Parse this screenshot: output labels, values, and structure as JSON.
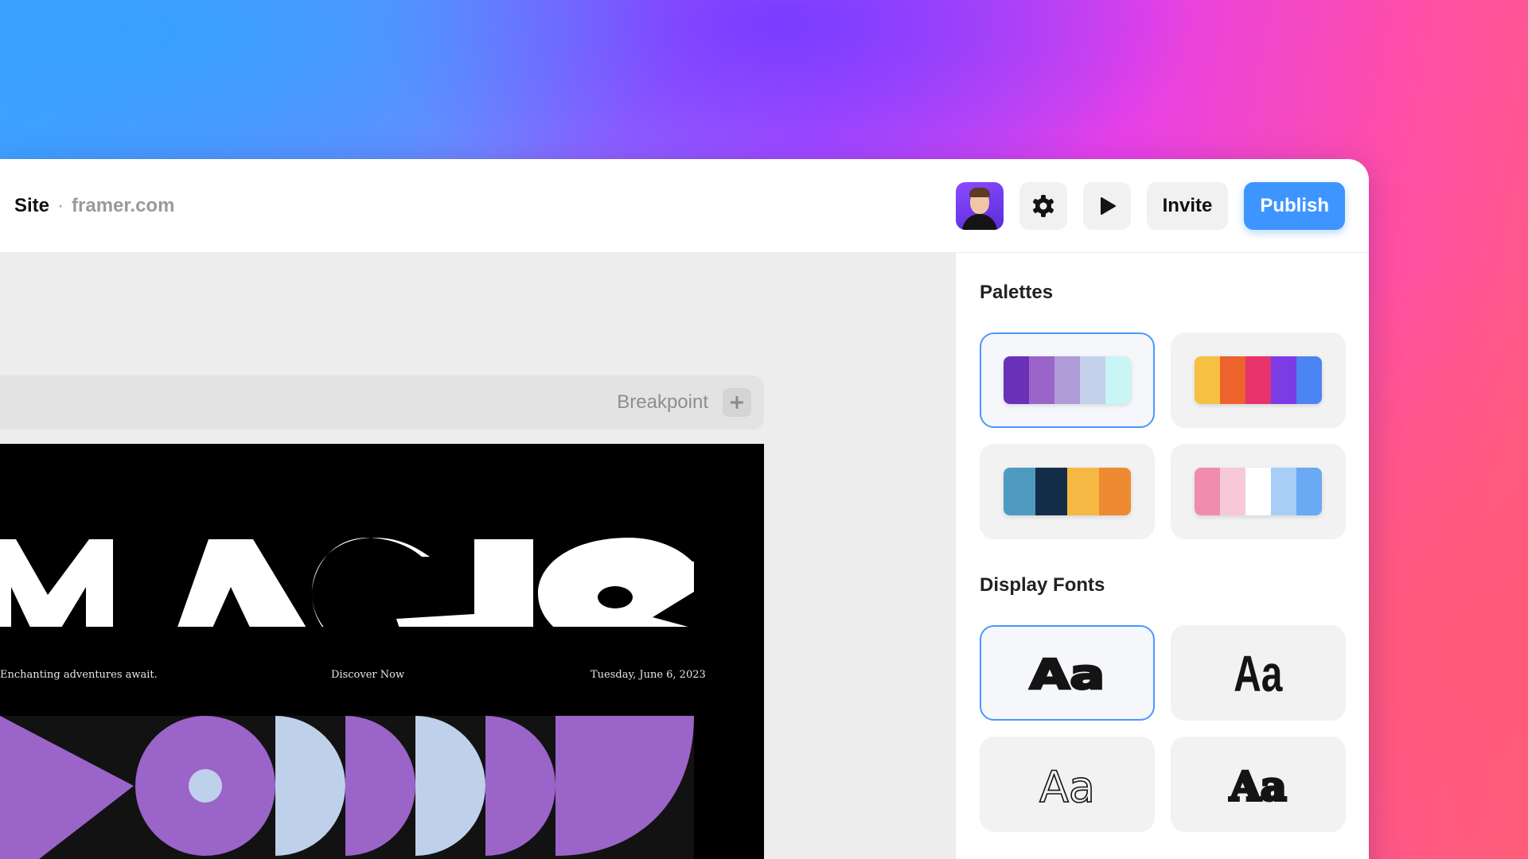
{
  "topbar": {
    "site_title": "Site",
    "separator": "·",
    "domain": "framer.com",
    "invite_label": "Invite",
    "publish_label": "Publish"
  },
  "canvas": {
    "breakpoint_label": "Breakpoint"
  },
  "artboard": {
    "headline": "MAGIC",
    "tagline": "Enchanting adventures await.",
    "cta": "Discover Now",
    "date": "Tuesday, June 6, 2023"
  },
  "panel": {
    "palettes_title": "Palettes",
    "fonts_title": "Display Fonts",
    "palettes": [
      {
        "selected": true,
        "colors": [
          "#6a30b8",
          "#9b64c8",
          "#b09ad8",
          "#c4d0ec",
          "#c8f6f4"
        ]
      },
      {
        "selected": false,
        "colors": [
          "#f6c043",
          "#ec632c",
          "#e7336c",
          "#7b3de3",
          "#4b84f3"
        ]
      },
      {
        "selected": false,
        "colors": [
          "#4f9bc0",
          "#142e49",
          "#f5b843",
          "#ed8a32"
        ]
      },
      {
        "selected": false,
        "colors": [
          "#f08daf",
          "#f6c8da",
          "#ffffff",
          "#a8cdf6",
          "#6aa9f3"
        ]
      }
    ],
    "fonts": [
      {
        "sample": "Aa",
        "selected": true
      },
      {
        "sample": "Aa",
        "selected": false
      },
      {
        "sample": "Aa",
        "selected": false
      },
      {
        "sample": "Aa",
        "selected": false
      }
    ]
  },
  "colors": {
    "accent": "#3f95ff",
    "artboard_purple": "#9b64c8",
    "artboard_lightblue": "#bfd0ea"
  }
}
